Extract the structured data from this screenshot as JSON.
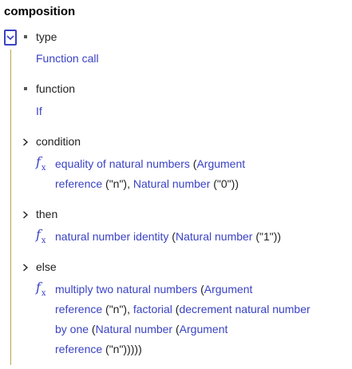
{
  "title": "composition",
  "type": {
    "label": "type",
    "value": "Function call"
  },
  "function": {
    "label": "function",
    "value": "If"
  },
  "condition": {
    "label": "condition",
    "fx": "f",
    "fx_sub": "x",
    "line1": {
      "a": "equality of natural numbers",
      "b": " (",
      "c": "Argument"
    },
    "line2": {
      "a": "reference",
      "b": " (\"n\"), ",
      "c": "Natural number",
      "d": " (\"0\"))"
    }
  },
  "then": {
    "label": "then",
    "fx": "f",
    "fx_sub": "x",
    "line1": {
      "a": "natural number identity",
      "b": "  (",
      "c": "Natural number",
      "d": " (\"1\"))"
    }
  },
  "else": {
    "label": "else",
    "fx": "f",
    "fx_sub": "x",
    "line1": {
      "a": "multiply two natural numbers",
      "b": " (",
      "c": "Argument"
    },
    "line2": {
      "a": "reference",
      "b": " (\"n\"), ",
      "c": "factorial",
      "d": " (",
      "e": "decrement natural number"
    },
    "line3": {
      "a": "by one",
      "b": " (",
      "c": "Natural number",
      "d": " (",
      "e": "Argument"
    },
    "line4": {
      "a": "reference",
      "b": " (\"n\")))))"
    }
  },
  "colors": {
    "link": "#3a42c4",
    "guide": "#b7a84a",
    "text": "#202122"
  }
}
